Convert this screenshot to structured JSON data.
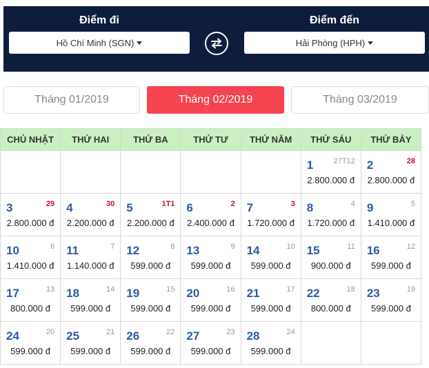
{
  "route": {
    "origin_label": "Điểm đi",
    "origin_value": "Hồ Chí Minh (SGN)",
    "destination_label": "Điểm đến",
    "destination_value": "Hải Phòng (HPH)"
  },
  "months": [
    {
      "label": "Tháng 01/2019",
      "active": false
    },
    {
      "label": "Tháng 02/2019",
      "active": true
    },
    {
      "label": "Tháng 03/2019",
      "active": false
    }
  ],
  "weekdays": [
    "CHỦ NHẬT",
    "THỨ HAI",
    "THỨ BA",
    "THỨ TƯ",
    "THỨ NĂM",
    "THỨ SÁU",
    "THỨ BẢY"
  ],
  "weeks": [
    [
      null,
      null,
      null,
      null,
      null,
      {
        "day": "1",
        "lunar": "27T12",
        "red": false,
        "price": "2.800.000 đ"
      },
      {
        "day": "2",
        "lunar": "28",
        "red": true,
        "price": "2.800.000 đ"
      }
    ],
    [
      {
        "day": "3",
        "lunar": "29",
        "red": true,
        "price": "2.800.000 đ"
      },
      {
        "day": "4",
        "lunar": "30",
        "red": true,
        "price": "2.200.000 đ"
      },
      {
        "day": "5",
        "lunar": "1T1",
        "red": true,
        "price": "2.200.000 đ"
      },
      {
        "day": "6",
        "lunar": "2",
        "red": true,
        "price": "2.400.000 đ"
      },
      {
        "day": "7",
        "lunar": "3",
        "red": true,
        "price": "1.720.000 đ"
      },
      {
        "day": "8",
        "lunar": "4",
        "red": false,
        "price": "1.720.000 đ"
      },
      {
        "day": "9",
        "lunar": "5",
        "red": false,
        "price": "1.410.000 đ"
      }
    ],
    [
      {
        "day": "10",
        "lunar": "6",
        "red": false,
        "price": "1.410.000 đ"
      },
      {
        "day": "11",
        "lunar": "7",
        "red": false,
        "price": "1.140.000 đ"
      },
      {
        "day": "12",
        "lunar": "8",
        "red": false,
        "price": "599.000 đ"
      },
      {
        "day": "13",
        "lunar": "9",
        "red": false,
        "price": "599.000 đ"
      },
      {
        "day": "14",
        "lunar": "10",
        "red": false,
        "price": "599.000 đ"
      },
      {
        "day": "15",
        "lunar": "11",
        "red": false,
        "price": "900.000 đ"
      },
      {
        "day": "16",
        "lunar": "12",
        "red": false,
        "price": "599.000 đ"
      }
    ],
    [
      {
        "day": "17",
        "lunar": "13",
        "red": false,
        "price": "800.000 đ"
      },
      {
        "day": "18",
        "lunar": "14",
        "red": false,
        "price": "599.000 đ"
      },
      {
        "day": "19",
        "lunar": "15",
        "red": false,
        "price": "599.000 đ"
      },
      {
        "day": "20",
        "lunar": "16",
        "red": false,
        "price": "599.000 đ"
      },
      {
        "day": "21",
        "lunar": "17",
        "red": false,
        "price": "599.000 đ"
      },
      {
        "day": "22",
        "lunar": "18",
        "red": false,
        "price": "800.000 đ"
      },
      {
        "day": "23",
        "lunar": "19",
        "red": false,
        "price": "599.000 đ"
      }
    ],
    [
      {
        "day": "24",
        "lunar": "20",
        "red": false,
        "price": "599.000 đ"
      },
      {
        "day": "25",
        "lunar": "21",
        "red": false,
        "price": "599.000 đ"
      },
      {
        "day": "26",
        "lunar": "22",
        "red": false,
        "price": "599.000 đ"
      },
      {
        "day": "27",
        "lunar": "23",
        "red": false,
        "price": "599.000 đ"
      },
      {
        "day": "28",
        "lunar": "24",
        "red": false,
        "price": "599.000 đ"
      },
      null,
      null
    ]
  ],
  "icons": {
    "swap": "swap-arrows-icon",
    "caret": "caret-down-icon"
  },
  "colors": {
    "header_bg": "#0f1d3d",
    "active_tab": "#f5444f",
    "weekday_header_bg": "#c9f0c1",
    "day_number": "#2a5aa8",
    "lunar_red": "#c8102e"
  }
}
